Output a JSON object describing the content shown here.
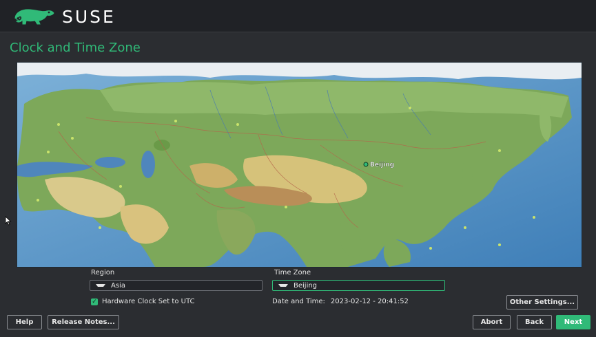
{
  "header": {
    "brand": "SUSE",
    "logo_icon": "chameleon-logo-icon"
  },
  "page": {
    "title": "Clock and Time Zone"
  },
  "map": {
    "selected_city": "Beijing"
  },
  "region": {
    "label": "Region",
    "value": "Asia"
  },
  "timezone": {
    "label": "Time Zone",
    "value": "Beijing"
  },
  "hardware_clock": {
    "label": "Hardware Clock Set to UTC",
    "checked": true
  },
  "datetime": {
    "label": "Date and Time:",
    "value": "2023-02-12 - 20:41:52"
  },
  "buttons": {
    "other_settings": "Other Settings...",
    "help": "Help",
    "release_notes": "Release Notes...",
    "abort": "Abort",
    "back": "Back",
    "next": "Next"
  },
  "colors": {
    "accent": "#30ba78",
    "background": "#2b2d31",
    "topbar": "#202226"
  }
}
